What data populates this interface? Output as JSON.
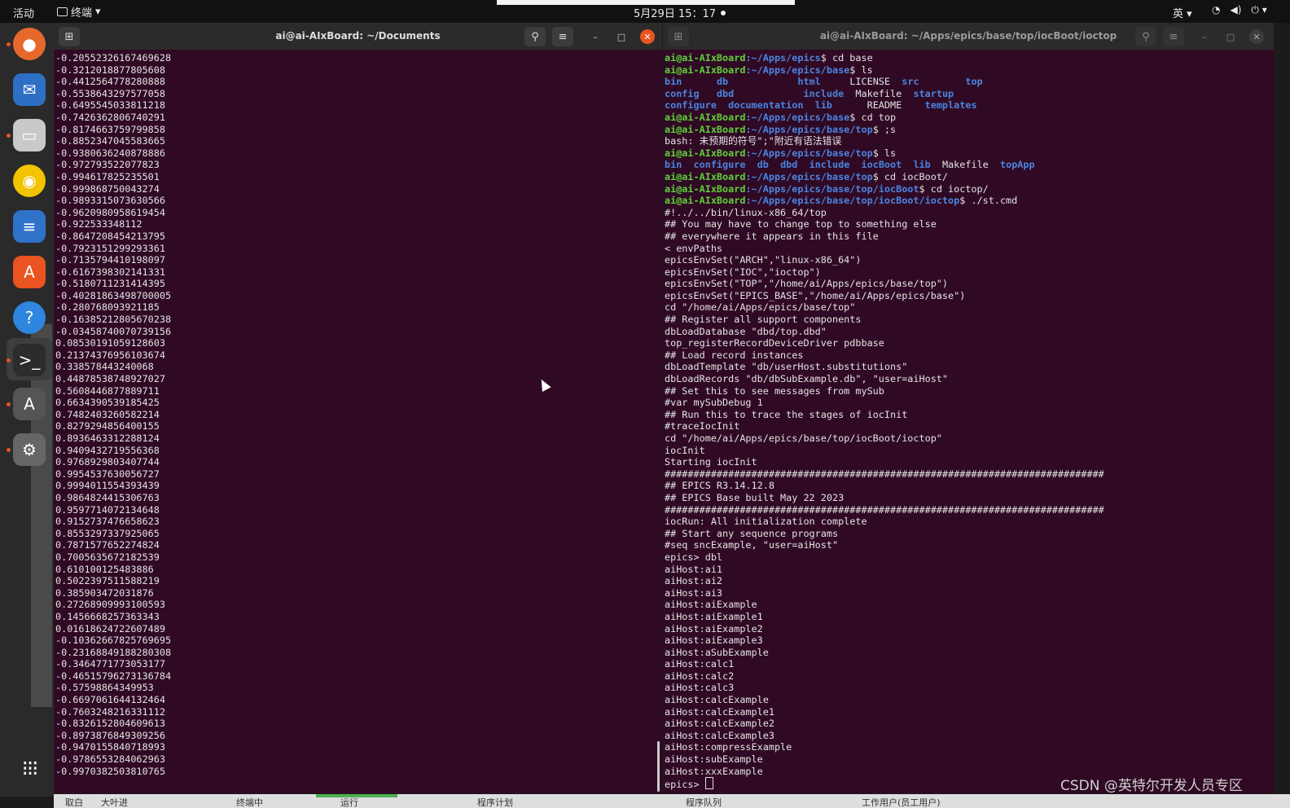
{
  "topbar": {
    "activities": "活动",
    "app_name": "终端",
    "app_arrow": "▾",
    "clock": "5月29日 15：17",
    "input_method": "英 ▾",
    "wifi": "◔",
    "volume": "◀)",
    "power": "⏻ ▾"
  },
  "dock": {
    "items": [
      {
        "name": "firefox",
        "glyph": "●",
        "color": "#e8682c"
      },
      {
        "name": "thunderbird",
        "glyph": "✉",
        "color": "#2d6fc4"
      },
      {
        "name": "files",
        "glyph": "▭",
        "color": "#c9c9c9"
      },
      {
        "name": "rhythmbox",
        "glyph": "◉",
        "color": "#f2c300"
      },
      {
        "name": "writer",
        "glyph": "≡",
        "color": "#2f72c9"
      },
      {
        "name": "software",
        "glyph": "A",
        "color": "#e95420"
      },
      {
        "name": "help",
        "glyph": "?",
        "color": "#2e86de"
      },
      {
        "name": "terminal",
        "glyph": ">_",
        "color": "#2c2c2c"
      },
      {
        "name": "updater",
        "glyph": "A",
        "color": "#555"
      },
      {
        "name": "settings",
        "glyph": "⚙",
        "color": "#666"
      }
    ],
    "apps_grid": "⁝⁝⁝"
  },
  "left_window": {
    "title": "ai@ai-AIxBoard: ~/Documents",
    "lines": [
      "-0.20552326167469628",
      "-0.3212018877805608",
      "-0.4412564778280888",
      "-0.5538643297577058",
      "-0.6495545033811218",
      "-0.7426362806740291",
      "-0.8174663759799858",
      "-0.8852347045583665",
      "-0.9380636240878886",
      "-0.972793522077823",
      "-0.994617825235501",
      "-0.999868750043274",
      "-0.9893315073630566",
      "-0.9620980958619454",
      "-0.922533348112",
      "-0.8647208454213795",
      "-0.7923151299293361",
      "-0.7135794410198097",
      "-0.6167398302141331",
      "-0.5180711231414395",
      "-0.40281863498700005",
      "-0.280768093921185",
      "-0.16385212805670238",
      "-0.03458740070739156",
      "0.08530191059128603",
      "0.21374376956103674",
      "0.338578443240068",
      "0.44878538748927027",
      "0.5608446877889711",
      "0.6634390539185425",
      "0.7482403260582214",
      "0.8279294856400155",
      "0.8936463312288124",
      "0.9409432719556368",
      "0.9768929803407744",
      "0.9954537630056727",
      "0.9994011554393439",
      "0.9864824415306763",
      "0.9597714072134648",
      "0.9152737476658623",
      "0.8553297337925065",
      "0.7871577652274824",
      "0.7005635672182539",
      "0.610100125483886",
      "0.5022397511588219",
      "0.385903472031876",
      "0.27268909993100593",
      "0.1456668257363343",
      "0.01618624722607489",
      "-0.10362667825769695",
      "-0.23168849188280308",
      "-0.3464771773053177",
      "-0.46515796273136784",
      "-0.57598864349953",
      "-0.6697061644132464",
      "-0.7603248216331112",
      "-0.8326152804609613",
      "-0.8973876849309256",
      "-0.9470155840718993",
      "-0.9786553284062963",
      "-0.9970382503810765"
    ]
  },
  "right_window": {
    "title": "ai@ai-AIxBoard: ~/Apps/epics/base/top/iocBoot/ioctop",
    "prompt_user": "ai@ai-AIxBoard",
    "lines": [
      {
        "user": "ai@ai-AIxBoard",
        "path": ":~/Apps/epics",
        "cmd": "$ cd base"
      },
      {
        "user": "ai@ai-AIxBoard",
        "path": ":~/Apps/epics/base",
        "cmd": "$ ls"
      },
      {
        "ls": [
          {
            "t": "bin",
            "c": "b"
          },
          {
            "t": "      db         ",
            "c": "b0"
          },
          {
            "t": "   html",
            "c": "b"
          },
          {
            "t": "     LICENSE  ",
            "c": "w"
          },
          {
            "t": "src",
            "c": "b"
          },
          {
            "t": "        top",
            "c": "b"
          }
        ]
      },
      {
        "ls": [
          {
            "t": "config",
            "c": "b"
          },
          {
            "t": "   dbd",
            "c": "b"
          },
          {
            "t": "            include",
            "c": "b"
          },
          {
            "t": "  Makefile  ",
            "c": "w"
          },
          {
            "t": "startup",
            "c": "b"
          }
        ]
      },
      {
        "ls": [
          {
            "t": "configure",
            "c": "b"
          },
          {
            "t": "  documentation",
            "c": "b"
          },
          {
            "t": "  lib",
            "c": "b"
          },
          {
            "t": "      README    ",
            "c": "w"
          },
          {
            "t": "templates",
            "c": "b"
          }
        ]
      },
      {
        "user": "ai@ai-AIxBoard",
        "path": ":~/Apps/epics/base",
        "cmd": "$ cd top"
      },
      {
        "user": "ai@ai-AIxBoard",
        "path": ":~/Apps/epics/base/top",
        "cmd": "$ ;s"
      },
      {
        "text": "bash: 未预期的符号\";\"附近有语法错误"
      },
      {
        "user": "ai@ai-AIxBoard",
        "path": ":~/Apps/epics/base/top",
        "cmd": "$ ls"
      },
      {
        "ls": [
          {
            "t": "bin",
            "c": "b"
          },
          {
            "t": "  configure",
            "c": "b"
          },
          {
            "t": "  db",
            "c": "b"
          },
          {
            "t": "  dbd",
            "c": "b"
          },
          {
            "t": "  include",
            "c": "b"
          },
          {
            "t": "  iocBoot",
            "c": "b"
          },
          {
            "t": "  lib",
            "c": "b"
          },
          {
            "t": "  Makefile  ",
            "c": "w"
          },
          {
            "t": "topApp",
            "c": "b"
          }
        ]
      },
      {
        "user": "ai@ai-AIxBoard",
        "path": ":~/Apps/epics/base/top",
        "cmd": "$ cd iocBoot/"
      },
      {
        "user": "ai@ai-AIxBoard",
        "path": ":~/Apps/epics/base/top/iocBoot",
        "cmd": "$ cd ioctop/"
      },
      {
        "user": "ai@ai-AIxBoard",
        "path": ":~/Apps/epics/base/top/iocBoot/ioctop",
        "cmd": "$ ./st.cmd"
      },
      {
        "text": "#!../../bin/linux-x86_64/top"
      },
      {
        "text": "## You may have to change top to something else"
      },
      {
        "text": "## everywhere it appears in this file"
      },
      {
        "text": "< envPaths"
      },
      {
        "text": "epicsEnvSet(\"ARCH\",\"linux-x86_64\")"
      },
      {
        "text": "epicsEnvSet(\"IOC\",\"ioctop\")"
      },
      {
        "text": "epicsEnvSet(\"TOP\",\"/home/ai/Apps/epics/base/top\")"
      },
      {
        "text": "epicsEnvSet(\"EPICS_BASE\",\"/home/ai/Apps/epics/base\")"
      },
      {
        "text": "cd \"/home/ai/Apps/epics/base/top\""
      },
      {
        "text": "## Register all support components"
      },
      {
        "text": "dbLoadDatabase \"dbd/top.dbd\""
      },
      {
        "text": "top_registerRecordDeviceDriver pdbbase"
      },
      {
        "text": "## Load record instances"
      },
      {
        "text": "dbLoadTemplate \"db/userHost.substitutions\""
      },
      {
        "text": "dbLoadRecords \"db/dbSubExample.db\", \"user=aiHost\""
      },
      {
        "text": "## Set this to see messages from mySub"
      },
      {
        "text": "#var mySubDebug 1"
      },
      {
        "text": "## Run this to trace the stages of iocInit"
      },
      {
        "text": "#traceIocInit"
      },
      {
        "text": "cd \"/home/ai/Apps/epics/base/top/iocBoot/ioctop\""
      },
      {
        "text": "iocInit"
      },
      {
        "text": "Starting iocInit"
      },
      {
        "text": "############################################################################"
      },
      {
        "text": "## EPICS R3.14.12.8"
      },
      {
        "text": "## EPICS Base built May 22 2023"
      },
      {
        "text": "############################################################################"
      },
      {
        "text": "iocRun: All initialization complete"
      },
      {
        "text": "## Start any sequence programs"
      },
      {
        "text": "#seq sncExample, \"user=aiHost\""
      },
      {
        "text": "epics> dbl"
      },
      {
        "text": "aiHost:ai1"
      },
      {
        "text": "aiHost:ai2"
      },
      {
        "text": "aiHost:ai3"
      },
      {
        "text": "aiHost:aiExample"
      },
      {
        "text": "aiHost:aiExample1"
      },
      {
        "text": "aiHost:aiExample2"
      },
      {
        "text": "aiHost:aiExample3"
      },
      {
        "text": "aiHost:aSubExample"
      },
      {
        "text": "aiHost:calc1"
      },
      {
        "text": "aiHost:calc2"
      },
      {
        "text": "aiHost:calc3"
      },
      {
        "text": "aiHost:calcExample"
      },
      {
        "text": "aiHost:calcExample1"
      },
      {
        "text": "aiHost:calcExample2"
      },
      {
        "text": "aiHost:calcExample3"
      },
      {
        "text": "aiHost:compressExample"
      },
      {
        "text": "aiHost:subExample"
      },
      {
        "text": "aiHost:xxxExample"
      },
      {
        "prompt": "epics> "
      }
    ]
  },
  "bottombar": {
    "segments": [
      "取白",
      "大叶进",
      "终端中",
      "运行",
      "程序计划",
      "程序队列",
      "工作用户(员工用户)"
    ]
  },
  "watermark": "CSDN @英特尔开发人员专区"
}
